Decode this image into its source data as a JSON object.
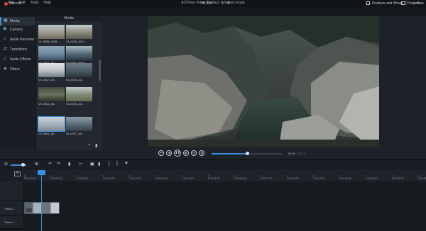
{
  "app": {
    "menu": [
      "File",
      "Edit",
      "Tools",
      "Help"
    ],
    "title": "ACDSee Video Studio 3 - Untitled.avspe"
  },
  "toolbar": {
    "record_label": "Record",
    "zoom_value": "84.5%",
    "produce_label": "Produce and Share",
    "properties_label": "Properties"
  },
  "sidebar": {
    "items": [
      {
        "label": "Media",
        "icon": "film-icon"
      },
      {
        "label": "Camera",
        "icon": "camera-icon"
      },
      {
        "label": "Audio Recorder",
        "icon": "microphone-icon"
      },
      {
        "label": "Transitions",
        "icon": "transitions-icon"
      },
      {
        "label": "Audio Effects",
        "icon": "audio-effects-icon"
      },
      {
        "label": "Filters",
        "icon": "filters-icon"
      }
    ]
  },
  "media": {
    "header": "Media",
    "thumbs": [
      {
        "caption": "V1-0008_0028..."
      },
      {
        "caption": "V1-0009_A017..."
      },
      {
        "caption": "V1-0010_A0..."
      },
      {
        "caption": "V1-0011_A015..."
      },
      {
        "caption": "V1-0012_D2..."
      },
      {
        "caption": "V1-0013_A0..."
      },
      {
        "caption": "V1-0014_A0..."
      },
      {
        "caption": "V1-0015_A0..."
      },
      {
        "caption": "V1-0016_A0..."
      },
      {
        "caption": "V1-0017_A0..."
      }
    ]
  },
  "transport": {
    "time_current": "00:00",
    "time_total": "/ 00:18",
    "progress": 0.5
  },
  "timeline": {
    "ruler_labels": [
      "0:00:00:00",
      "0:00:03:00",
      "0:00:06:00",
      "0:00:09:00",
      "0:00:12:00",
      "0:00:15:00",
      "0:00:18:00",
      "0:00:21:00",
      "0:00:24:00",
      "0:00:27:00",
      "0:00:30:00",
      "0:00:33:00",
      "0:00:36:00",
      "0:00:39:00",
      "0:00:42:00",
      "0:00:45:00"
    ],
    "tracks": [
      {
        "name": "Track 2"
      },
      {
        "name": "Track 1"
      }
    ]
  },
  "colors": {
    "accent": "#3b8fe0",
    "record": "#e04a3c"
  }
}
